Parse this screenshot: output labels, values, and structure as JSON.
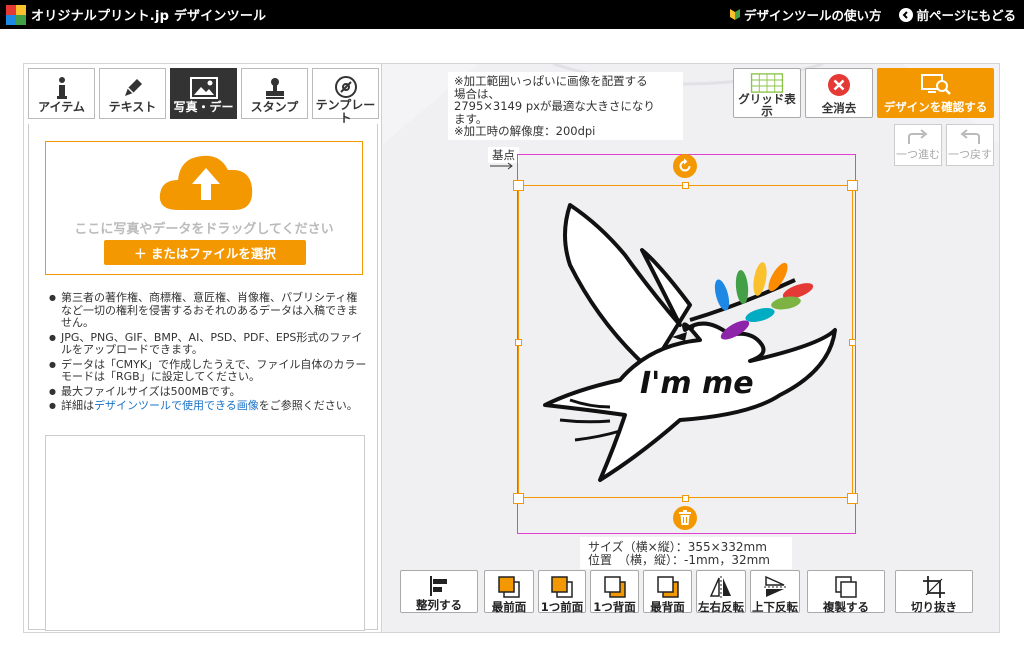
{
  "header": {
    "brand": "オリジナルプリント.jp デザインツール",
    "how_to_label": "デザインツールの使い方",
    "back_label": "前ページにもどる"
  },
  "tabs": [
    {
      "label": "アイテム",
      "icon": "info-icon"
    },
    {
      "label": "テキスト",
      "icon": "pen-icon"
    },
    {
      "label": "写真・デー",
      "icon": "image-icon",
      "active": true
    },
    {
      "label": "スタンプ",
      "icon": "stamp-icon"
    },
    {
      "label": "テンプレー",
      "label2": "ト",
      "icon": "template-icon"
    }
  ],
  "upload": {
    "drop_text": "ここに写真やデータをドラッグしてください",
    "select_button": "＋ またはファイルを選択"
  },
  "notes": [
    "第三者の著作権、商標権、意匠権、肖像権、パブリシティ権など一切の権利を侵害するおそれのあるデータは入稿できません。",
    "JPG、PNG、GIF、BMP、AI、PSD、PDF、EPS形式のファイルをアップロードできます。",
    "データは「CMYK」で作成したうえで、ファイル自体のカラーモードは「RGB」に設定してください。",
    "最大ファイルサイズは500MBです。"
  ],
  "note_link": {
    "prefix": "詳細は",
    "link": "デザインツールで使用できる画像",
    "suffix": "をご参照ください。"
  },
  "info": {
    "line1": "※加工範囲いっぱいに画像を配置する",
    "line2": "場合は、",
    "line3": "2795×3149 pxが最適な大きさになり",
    "line4": "ます。",
    "line5": "※加工時の解像度：200dpi"
  },
  "actions": {
    "grid": "グリッド表",
    "grid2": "示",
    "clear": "全消去",
    "confirm": "デザインを確認する",
    "redo": "一つ進む",
    "undo": "一つ戻す"
  },
  "canvas": {
    "origin_label": "基点",
    "design_text": "I'm me"
  },
  "size_info": {
    "size": "サイズ（横×縦）：355×332mm",
    "position": "位置　（横，縦）：-1mm，32mm"
  },
  "toolbar": {
    "align": "整列する",
    "front_most": "最前面",
    "forward": "1つ前面",
    "backward": "1つ背面",
    "back_most": "最背面",
    "flip_h": "左右反転",
    "flip_v": "上下反転",
    "duplicate": "複製する",
    "crop": "切り抜き"
  },
  "colors": {
    "accent": "#f39800",
    "selection": "#e040d0",
    "danger": "#e53935"
  }
}
